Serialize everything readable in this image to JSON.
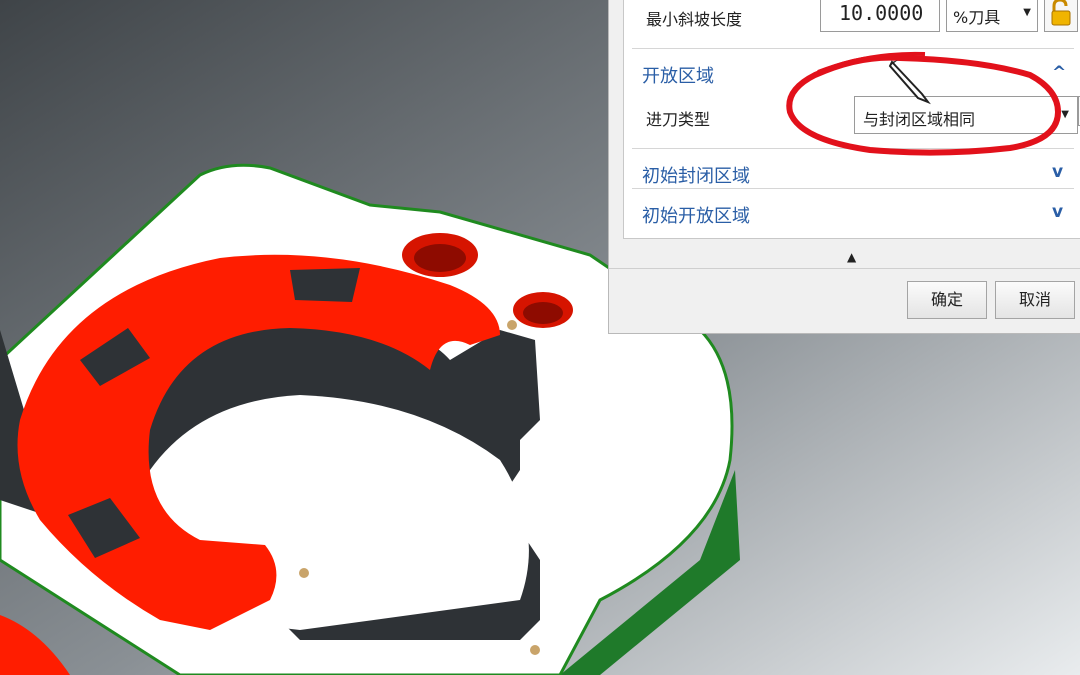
{
  "panel": {
    "ramp_length_label": "最小斜坡长度",
    "ramp_length_value": "10.0000",
    "ramp_length_unit": "%刀具",
    "open_area_title": "开放区域",
    "engage_type_label": "进刀类型",
    "engage_type_value": "与封闭区域相同",
    "initial_closed_title": "初始封闭区域",
    "initial_open_title": "初始开放区域"
  },
  "buttons": {
    "ok_label": "确定",
    "cancel_label": "取消"
  },
  "icons": {
    "expand_up": "^",
    "expand_down": "v",
    "collapse_arrow": "▲",
    "dropdown_arrow": "▼"
  },
  "colors": {
    "section_title": "#2a5ea6",
    "annotation_red": "#e2111b",
    "highlight_face": "#ff1d00",
    "edge_green": "#1f8a1f"
  }
}
